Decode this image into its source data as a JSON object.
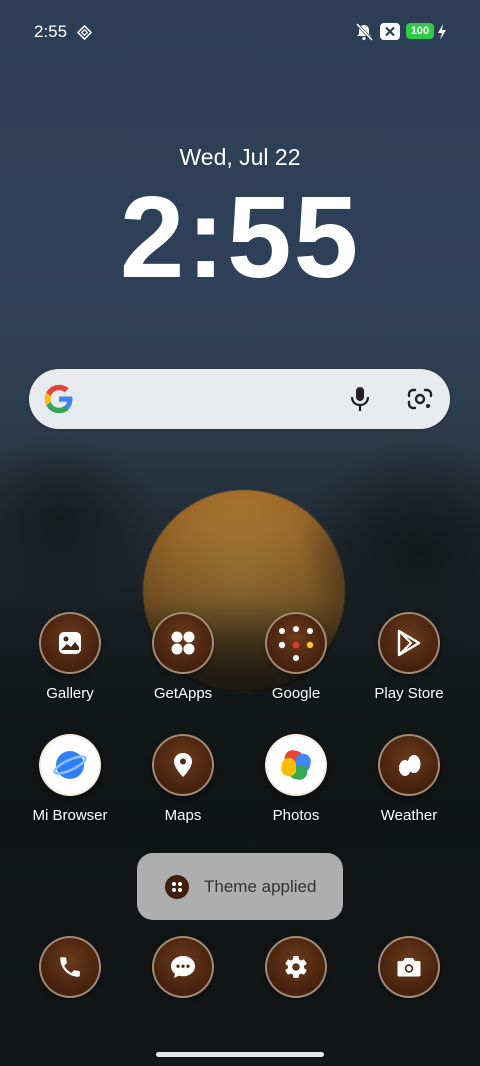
{
  "status_bar": {
    "time": "2:55",
    "battery_level": "100",
    "icons": [
      "vpn-diamond-icon",
      "bell-off-icon",
      "close-box-icon",
      "charging-bolt-icon"
    ]
  },
  "clock": {
    "date": "Wed, Jul 22",
    "time": "2:55"
  },
  "search": {
    "icons": [
      "google-g-logo",
      "microphone-icon",
      "google-lens-icon"
    ]
  },
  "apps_row1": [
    {
      "label": "Gallery",
      "icon": "gallery-icon"
    },
    {
      "label": "GetApps",
      "icon": "getapps-icon"
    },
    {
      "label": "Google",
      "icon": "google-folder-icon"
    },
    {
      "label": "Play Store",
      "icon": "play-store-icon"
    }
  ],
  "apps_row2": [
    {
      "label": "Mi Browser",
      "icon": "mi-browser-icon"
    },
    {
      "label": "Maps",
      "icon": "maps-icon"
    },
    {
      "label": "Photos",
      "icon": "photos-icon"
    },
    {
      "label": "Weather",
      "icon": "weather-icon"
    }
  ],
  "toast": {
    "text": "Theme applied"
  },
  "dock": [
    {
      "icon": "phone-icon"
    },
    {
      "icon": "messages-icon"
    },
    {
      "icon": "settings-icon"
    },
    {
      "icon": "camera-icon"
    }
  ],
  "colors": {
    "icon_bg": "#4a2510",
    "battery_green": "#31c948",
    "search_bg": "#e8ebee"
  }
}
